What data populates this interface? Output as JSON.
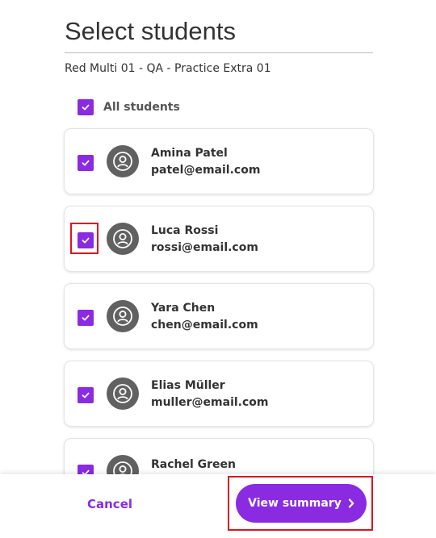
{
  "page": {
    "title": "Select students",
    "subtitle": "Red Multi 01 - QA - Practice Extra 01"
  },
  "select_all": {
    "label": "All students",
    "checked": true
  },
  "students": [
    {
      "name": "Amina Patel",
      "email": "patel@email.com",
      "checked": true
    },
    {
      "name": "Luca Rossi",
      "email": "rossi@email.com",
      "checked": true
    },
    {
      "name": "Yara Chen",
      "email": "chen@email.com",
      "checked": true
    },
    {
      "name": "Elias Müller",
      "email": "muller@email.com",
      "checked": true
    },
    {
      "name": "Rachel Green",
      "email": "",
      "checked": true
    }
  ],
  "footer": {
    "cancel_label": "Cancel",
    "summary_label": "View summary"
  },
  "colors": {
    "accent": "#8a2be2",
    "highlight": "#e0141e",
    "avatar": "#616161"
  },
  "icons": {
    "check": "check-icon",
    "avatar": "user-avatar-icon",
    "chevron": "chevron-right-icon"
  }
}
